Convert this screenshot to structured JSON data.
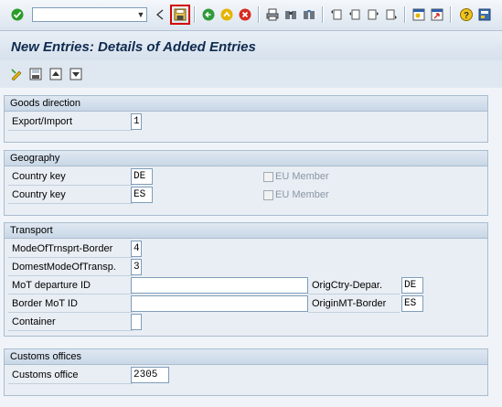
{
  "page": {
    "title": "New Entries: Details of Added Entries"
  },
  "toolbar": {
    "command_field_value": "",
    "icons": [
      "enter-icon",
      "back-arrow-icon",
      "save-icon",
      "back-icon",
      "exit-icon",
      "cancel-icon",
      "print-icon",
      "find-icon",
      "find-next-icon",
      "first-page-icon",
      "previous-page-icon",
      "next-page-icon",
      "last-page-icon",
      "create-session-icon",
      "shortcut-icon",
      "help-icon",
      "layout-menu-icon"
    ]
  },
  "app_toolbar": {
    "icons": [
      "change-display-icon",
      "save-local-icon",
      "previous-entry-icon",
      "next-entry-icon"
    ]
  },
  "goods_direction": {
    "header": "Goods direction",
    "export_import_label": "Export/Import",
    "export_import_value": "1"
  },
  "geography": {
    "header": "Geography",
    "rows": [
      {
        "label": "Country key",
        "value": "DE",
        "eu_label": "EU Member"
      },
      {
        "label": "Country key",
        "value": "ES",
        "eu_label": "EU Member"
      }
    ]
  },
  "transport": {
    "header": "Transport",
    "mode_border_label": "ModeOfTrnsprt-Border",
    "mode_border_value": "4",
    "domestic_mode_label": "DomestModeOfTransp.",
    "domestic_mode_value": "3",
    "mot_departure_label": "MoT departure ID",
    "mot_departure_value": "",
    "orig_ctry_label": "OrigCtry-Depar.",
    "orig_ctry_value": "DE",
    "border_mot_label": "Border MoT ID",
    "border_mot_value": "",
    "origin_mt_label": "OriginMT-Border",
    "origin_mt_value": "ES",
    "container_label": "Container",
    "container_value": ""
  },
  "customs": {
    "header": "Customs offices",
    "office_label": "Customs office",
    "office_value": "2305"
  },
  "colors": {
    "title": "#0e2b4f",
    "save_highlight": "#d40000",
    "enter_check": "#2a9d2a",
    "back_green": "#2f9a3a",
    "exit_yellow": "#e5b400",
    "cancel_red": "#d62b1f"
  }
}
